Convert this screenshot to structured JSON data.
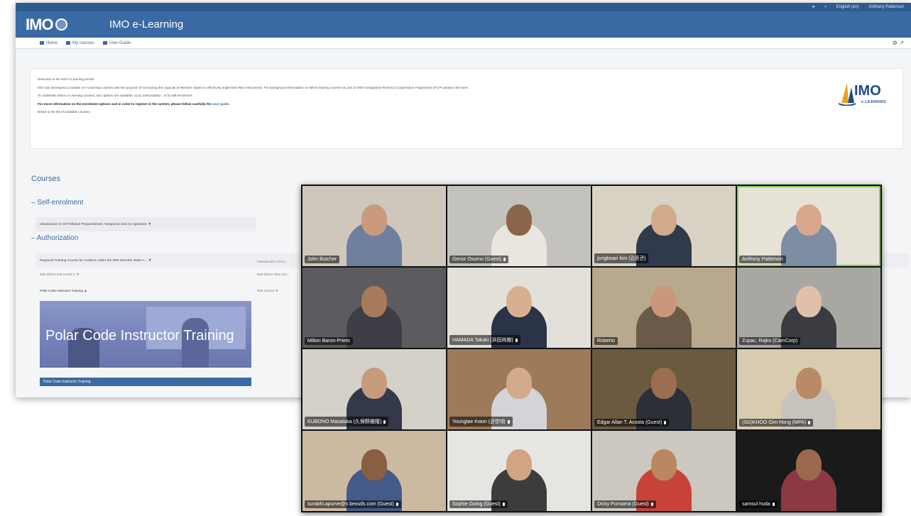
{
  "portal": {
    "brand_logo": "IMO",
    "site_title": "IMO e-Learning",
    "util": {
      "language": "English (en)",
      "user": "Anthony Patterson"
    },
    "nav": [
      {
        "label": "Home",
        "icon": "home-icon"
      },
      {
        "label": "My courses",
        "icon": "courses-icon"
      },
      {
        "label": "User Guide",
        "icon": "guide-icon"
      }
    ],
    "welcome": {
      "line1": "Welcome to the IMO e-Learning portal!",
      "line2": "IMO has developed a number of e-Learning courses with the purpose of increasing the capacity of Member States to effectively implement IMO instruments. For background information on IMO's training courses as part of IMO's Integrated Technical Cooperation Programme (ITCP) please click here.",
      "line3": "To undertake IMO's e-Learning courses, two options are available: a) by authorization , or b) self-enrolment.",
      "line4": "For more information on the enrolment options and in order to register in the system, please follow carefully the",
      "line4_link": "user guide.",
      "line5": "Below is the list of available courses."
    },
    "side_logo": {
      "word": "IMO",
      "sub": "e-LEARNING"
    },
    "courses_heading": "Courses",
    "self_enrolment": {
      "label": "Self-enrolment",
      "courses": [
        "Introduction to Oil Pollution Preparedness, Response and Co-operation"
      ]
    },
    "authorization": {
      "label": "Authorization",
      "col1": [
        "Regional Training Course for Auditors under the IMO Member State A...",
        "IMO Ethics test course 2",
        "Polar Code Instructor Training"
      ],
      "col2": [
        "Introducción a la O...",
        "IMO Ethics Test Cou...",
        "Test Course"
      ]
    },
    "polar_card": {
      "title": "Polar Code Instructor Training",
      "footer": "Polar Code Instructor Training"
    }
  },
  "zoom": {
    "participants": [
      {
        "name": "John Butcher",
        "bg": "#cfc7bc",
        "shirt": "#6f7f9e",
        "skin": "#c99b7c",
        "muted": false
      },
      {
        "name": "Genor Osumo (Guest)",
        "bg": "#c4c2bd",
        "shirt": "#e8e6df",
        "skin": "#8a6549",
        "muted": true
      },
      {
        "name": "jongkwan kim (김종관)",
        "bg": "#d9d3c5",
        "shirt": "#2f3a4c",
        "skin": "#d2ab8a",
        "muted": false
      },
      {
        "name": "Anthony Patterson",
        "bg": "#e7e2d6",
        "shirt": "#7d8da3",
        "skin": "#d7a88b",
        "muted": false,
        "active": true
      },
      {
        "name": "Milton Baron-Prieto",
        "bg": "#5c5b60",
        "shirt": "#3e3e46",
        "skin": "#a77a5a",
        "muted": false
      },
      {
        "name": "HAMADA Takaki (浜田尚樹)",
        "bg": "#e3e0d9",
        "shirt": "#2a3347",
        "skin": "#d9b08f",
        "muted": true
      },
      {
        "name": "Roberto",
        "bg": "#b8a88e",
        "shirt": "#6b5a48",
        "skin": "#c9987c",
        "muted": false
      },
      {
        "name": "Zupac, Rajko (CarnCorp)",
        "bg": "#a9a7a2",
        "shirt": "#3a3c42",
        "skin": "#e0c0a8",
        "muted": false
      },
      {
        "name": "KUBONO Masataka (久保野雅隆)",
        "bg": "#d5d1c9",
        "shirt": "#33394a",
        "skin": "#c69c7d",
        "muted": true
      },
      {
        "name": "Youngtae Kwon (권영태)",
        "bg": "#9c7a5a",
        "shirt": "#d2d4d8",
        "skin": "#d4aa8c",
        "muted": true
      },
      {
        "name": "Edgar Allan T. Acosta (Guest)",
        "bg": "#6b5a40",
        "shirt": "#2d2f38",
        "skin": "#9a6e4f",
        "muted": true
      },
      {
        "name": "(SG)KHOO Gim Hong (MPA)",
        "bg": "#d9cbb0",
        "shirt": "#c7c3bc",
        "skin": "#b98a66",
        "muted": true
      },
      {
        "name": "surabhi.apurve@n.bexutls.com (Guest)",
        "bg": "#cbb9a2",
        "shirt": "#445a88",
        "skin": "#8a5e40",
        "muted": true
      },
      {
        "name": "Sophie Going (Guest)",
        "bg": "#e7e5e1",
        "shirt": "#3c3c3e",
        "skin": "#d2a484",
        "muted": true
      },
      {
        "name": "Dicky Purnama (Guest)",
        "bg": "#ccc7bf",
        "shirt": "#c7433a",
        "skin": "#b98860",
        "muted": true
      },
      {
        "name": "samsul huda",
        "bg": "#1a1a1a",
        "shirt": "#8b3a45",
        "skin": "#9a6a4c",
        "muted": true
      }
    ]
  }
}
